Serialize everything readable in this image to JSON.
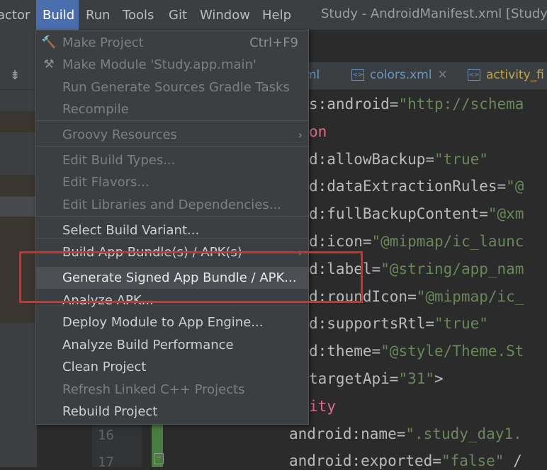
{
  "menubar": {
    "items": [
      "actor",
      "Build",
      "Run",
      "Tools",
      "Git",
      "Window",
      "Help"
    ],
    "title": "Study - AndroidManifest.xml [Study.a"
  },
  "tabs": [
    {
      "label": "ml",
      "icon": "xml-icon"
    },
    {
      "label": "colors.xml",
      "icon": "xml-icon"
    },
    {
      "label": "activity_fi",
      "icon": "xml-icon"
    }
  ],
  "code_lines": [
    {
      "parts": [
        [
          "attr",
          "s:android="
        ],
        [
          "str",
          "\"http://schema"
        ]
      ]
    },
    {
      "parts": [
        [
          "pink",
          "on"
        ]
      ]
    },
    {
      "parts": [
        [
          "attr",
          "d:allowBackup="
        ],
        [
          "str",
          "\"true\""
        ]
      ]
    },
    {
      "parts": [
        [
          "attr",
          "d:dataExtractionRules="
        ],
        [
          "str",
          "\"@"
        ]
      ]
    },
    {
      "parts": [
        [
          "attr",
          "d:fullBackupContent="
        ],
        [
          "str",
          "\"@xm"
        ]
      ]
    },
    {
      "parts": [
        [
          "attr",
          "d:icon="
        ],
        [
          "str",
          "\"@mipmap/ic_launc"
        ]
      ]
    },
    {
      "parts": [
        [
          "attr",
          "d:label="
        ],
        [
          "str",
          "\"@string/app_nam"
        ]
      ]
    },
    {
      "parts": [
        [
          "attr",
          "d:roundIcon="
        ],
        [
          "str",
          "\"@mipmap/ic_"
        ]
      ]
    },
    {
      "parts": [
        [
          "attr",
          "d:supportsRtl="
        ],
        [
          "str",
          "\"true\""
        ]
      ]
    },
    {
      "parts": [
        [
          "attr",
          "d:theme="
        ],
        [
          "str",
          "\"@style/Theme.St"
        ]
      ]
    },
    {
      "parts": [
        [
          "attr",
          "targetApi="
        ],
        [
          "str",
          "\"31\""
        ],
        [
          "attr",
          ">"
        ]
      ]
    },
    {
      "parts": [
        [
          "pink",
          "ity"
        ]
      ]
    },
    {
      "parts": [
        [
          "attr",
          "android:name="
        ],
        [
          "str",
          "\".study_day1."
        ]
      ]
    },
    {
      "parts": [
        [
          "attr",
          "android:exported="
        ],
        [
          "str",
          "\"false\""
        ],
        [
          "attr",
          " /"
        ]
      ]
    }
  ],
  "line_numbers": [
    "16",
    "17"
  ],
  "build_menu": {
    "items": [
      {
        "label": "Make Project",
        "shortcut": "Ctrl+F9",
        "state": "disabled",
        "icon": "hammer-icon"
      },
      {
        "label": "Make Module 'Study.app.main'",
        "state": "disabled",
        "icon": "hammer-module-icon"
      },
      {
        "label": "Run Generate Sources Gradle Tasks",
        "state": "disabled"
      },
      {
        "label": "Recompile",
        "state": "disabled"
      },
      {
        "label": "Groovy Resources",
        "state": "disabled",
        "submenu": true
      },
      {
        "label": "Edit Build Types...",
        "state": "disabled"
      },
      {
        "label": "Edit Flavors...",
        "state": "disabled"
      },
      {
        "label": "Edit Libraries and Dependencies...",
        "state": "disabled"
      },
      {
        "label": "Select Build Variant...",
        "state": "enabled"
      },
      {
        "label": "Build App Bundle(s) / APK(s)",
        "state": "enabled",
        "submenu": true
      },
      {
        "label": "Generate Signed App Bundle / APK...",
        "state": "selected"
      },
      {
        "label": "Analyze APK...",
        "state": "enabled"
      },
      {
        "label": "Deploy Module to App Engine...",
        "state": "enabled"
      },
      {
        "label": "Analyze Build Performance",
        "state": "enabled"
      },
      {
        "label": "Clean Project",
        "state": "enabled"
      },
      {
        "label": "Refresh Linked C++ Projects",
        "state": "disabled"
      },
      {
        "label": "Rebuild Project",
        "state": "enabled"
      }
    ]
  },
  "colors": {
    "highlight_box": "#d32f2f",
    "menubar_active": "#4b6eaf",
    "string": "#6a8759",
    "keyword_pink": "#e06c8a"
  }
}
